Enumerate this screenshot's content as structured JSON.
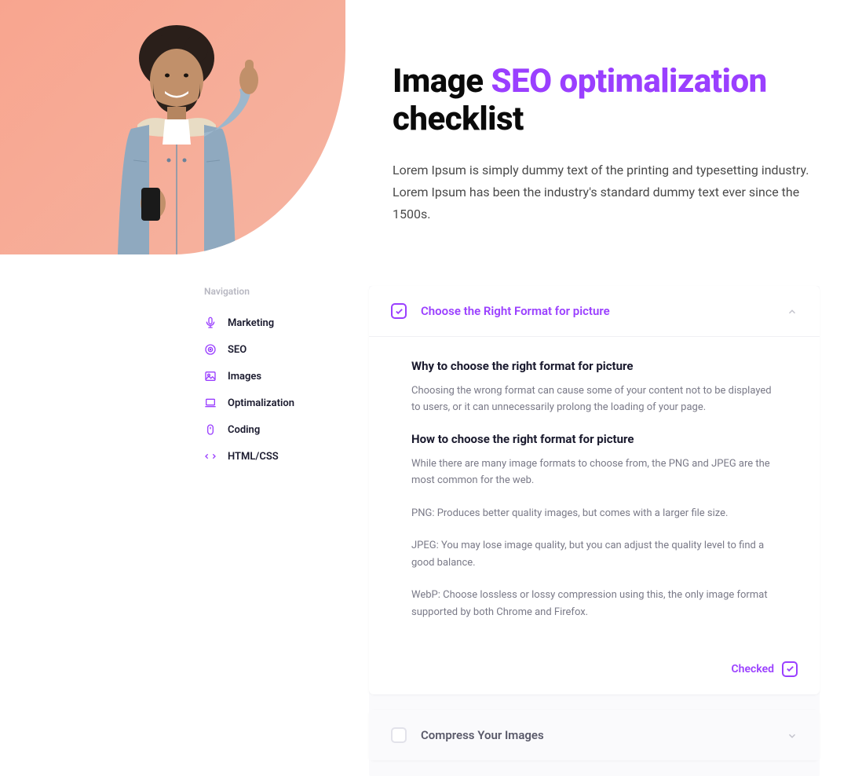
{
  "hero": {
    "title_pre": "Image ",
    "title_accent": "SEO optimalization",
    "title_post": " checklist",
    "description": "Lorem Ipsum is simply dummy text of the printing and typesetting industry. Lorem Ipsum has been the industry's standard dummy text ever since the 1500s."
  },
  "sidebar": {
    "heading": "Navigation",
    "items": [
      {
        "icon": "mic",
        "label": "Marketing"
      },
      {
        "icon": "target",
        "label": "SEO"
      },
      {
        "icon": "image",
        "label": "Images"
      },
      {
        "icon": "laptop",
        "label": "Optimalization"
      },
      {
        "icon": "mouse",
        "label": "Coding"
      },
      {
        "icon": "code",
        "label": "HTML/CSS"
      }
    ]
  },
  "checklist": {
    "items": [
      {
        "title": "Choose the Right Format for picture",
        "checked": true,
        "expanded": true,
        "sections": [
          {
            "heading": "Why to choose the right format for picture",
            "paragraphs": [
              "Choosing the wrong format can cause some of your content not to be displayed to users, or it can unnecessarily prolong the loading of your page."
            ]
          },
          {
            "heading": "How to choose the right format for picture",
            "paragraphs": [
              "While there are many image formats to choose from, the PNG and JPEG are the most common for the web.",
              "PNG: Produces better quality images, but comes with a larger file size.",
              "JPEG: You may lose image quality, but you can adjust the quality level to find a good balance.",
              "WebP: Choose lossless or lossy compression using this, the only image format supported by both Chrome and Firefox."
            ]
          }
        ],
        "footer_label": "Checked"
      },
      {
        "title": "Compress Your Images",
        "checked": false,
        "expanded": false
      }
    ]
  },
  "accent_color": "#9a3fff"
}
